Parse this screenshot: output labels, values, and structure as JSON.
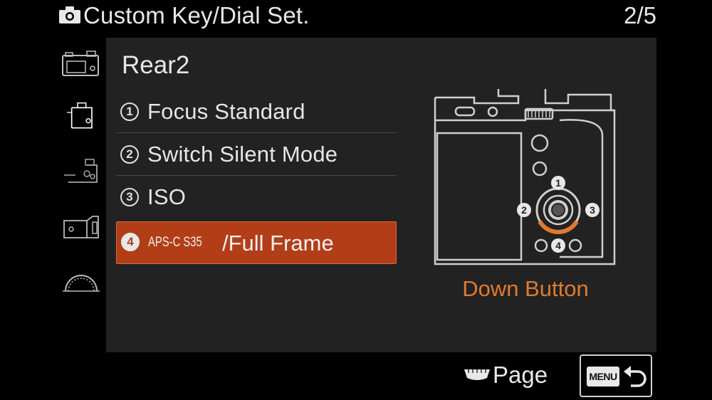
{
  "header": {
    "title": "Custom Key/Dial Set.",
    "page_indicator": "2/5",
    "icon": "camera-icon"
  },
  "sidebar": {
    "items": [
      {
        "icon": "camera-body-top-icon"
      },
      {
        "icon": "camera-body-side-icon"
      },
      {
        "icon": "camera-lens-icon"
      },
      {
        "icon": "camera-grip-icon"
      },
      {
        "icon": "dial-icon"
      }
    ]
  },
  "panel": {
    "section_title": "Rear2",
    "items": [
      {
        "number": "1",
        "label": "Focus Standard"
      },
      {
        "number": "2",
        "label": "Switch Silent Mode"
      },
      {
        "number": "3",
        "label": "ISO"
      },
      {
        "number": "4",
        "label_prefix": "APS-C S35",
        "label": "/Full Frame",
        "selected": true
      }
    ],
    "diagram": {
      "markers": [
        "1",
        "2",
        "3",
        "4"
      ],
      "caption": "Down Button",
      "highlight_color": "#e07a2e"
    }
  },
  "footer": {
    "page_label": "Page",
    "menu_label": "MENU"
  },
  "colors": {
    "selected_bg": "#b23e18",
    "accent": "#e07a2e",
    "panel_bg": "#222222"
  }
}
